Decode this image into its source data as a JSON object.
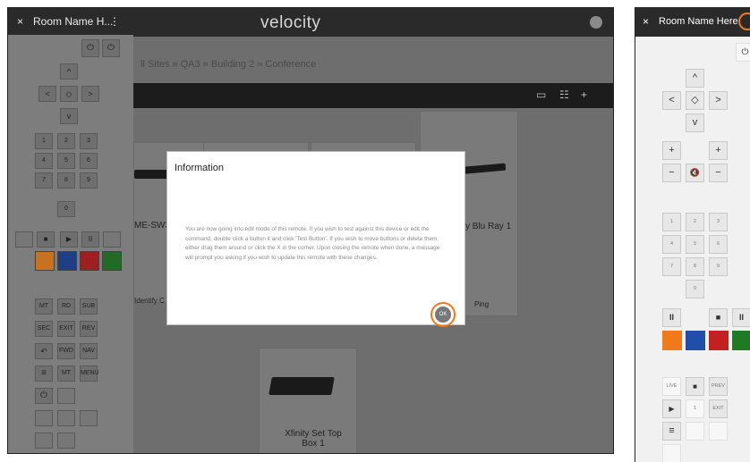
{
  "left_app": {
    "logo_text": "velocity",
    "breadcrumb": "ll Sites » QA3 » Building 2 » Conference",
    "toolbar_icons": [
      "screen-icon",
      "filter-icon",
      "plus-icon"
    ],
    "toolbar_plus": "+",
    "cards": [
      {
        "label": "ME-SW32",
        "action": "Identify  C"
      },
      {
        "label": "y Blu Ray 1",
        "action": "Ping"
      },
      {
        "label": "Xfinity Set Top Box 1"
      }
    ]
  },
  "left_remote": {
    "title": "Room Name H...",
    "kebab": "⋮",
    "buttons": {
      "up": "^",
      "left": "<",
      "center": "◇",
      "right": ">",
      "down": "v",
      "n1": "1",
      "n2": "2",
      "n3": "3",
      "n4": "4",
      "n5": "5",
      "n6": "6",
      "n7": "7",
      "n8": "8",
      "n9": "9",
      "n0": "0",
      "mt": "MT",
      "rd": "RD",
      "sub": "SUB",
      "sec": "SEC",
      "exit": "EXIT",
      "rev": "REV",
      "fwd": "FWD",
      "nav": "NAV",
      "menu": "MENU"
    }
  },
  "modal": {
    "title": "Information",
    "message": "You are now going into edit mode of this remote.  If you wish to test against this device or edit the command, double click a button it and click 'Test Button'.  If you wish to move buttons or delete them, either drag them around or click the X in the corner. Upon closing the remote when done, a message will prompt you asking if you wish to update this remote with these changes.",
    "ok_label": "OK",
    "accent": "#f07a1a"
  },
  "right_remote": {
    "close": "×",
    "title": "Room Name Here",
    "kebab": "⋮",
    "power": "⏻",
    "up": "^",
    "left": "<",
    "center": "◇",
    "right": ">",
    "down": "v",
    "vol_up": "+",
    "ch_up": "+",
    "vol_down": "−",
    "mute": "🔇",
    "ch_down": "−",
    "n1": "1",
    "n2": "2",
    "n3": "3",
    "n4": "4",
    "n5": "5",
    "n6": "6",
    "n7": "7",
    "n8": "8",
    "n9": "9",
    "n0": "0",
    "pause": "II",
    "stop": "■",
    "pause2": "II",
    "live": "LIVE",
    "stop2": "■",
    "prev": "PREV",
    "play": "▶",
    "one": "1",
    "exit": "EXIT",
    "menu": "≡",
    "swatches": [
      "#f07a1a",
      "#1f4fa8",
      "#c42020",
      "#1f7a22"
    ]
  }
}
